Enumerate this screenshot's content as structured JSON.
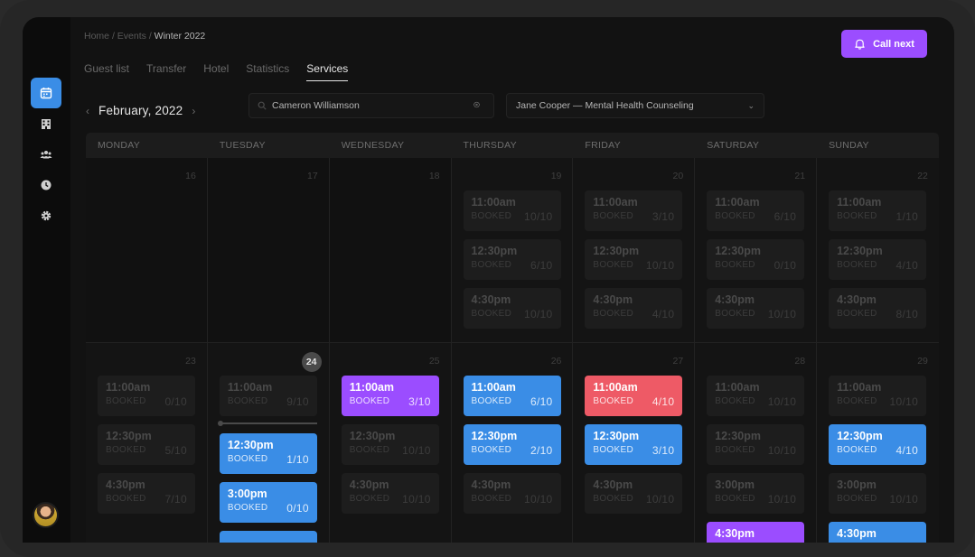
{
  "breadcrumb": {
    "items": [
      "Home",
      "Events"
    ],
    "separator": "/",
    "current": "Winter 2022"
  },
  "tabs": [
    {
      "label": "Guest list",
      "active": false
    },
    {
      "label": "Transfer",
      "active": false
    },
    {
      "label": "Hotel",
      "active": false
    },
    {
      "label": "Statistics",
      "active": false
    },
    {
      "label": "Services",
      "active": true
    }
  ],
  "call_button": {
    "label": "Call next",
    "icon": "bell-icon"
  },
  "sidebar": {
    "items": [
      {
        "name": "calendar",
        "icon": "calendar-icon",
        "active": true
      },
      {
        "name": "hotel",
        "icon": "building-icon",
        "active": false
      },
      {
        "name": "users",
        "icon": "users-icon",
        "active": false
      },
      {
        "name": "history",
        "icon": "clock-icon",
        "active": false
      },
      {
        "name": "settings",
        "icon": "gear-icon",
        "active": false
      }
    ]
  },
  "month": {
    "label": "February, 2022",
    "prev": "‹",
    "next": "›"
  },
  "search": {
    "value": "Cameron Williamson",
    "placeholder": "Search"
  },
  "service_select": {
    "value": "Jane Cooper — Mental Health Counseling"
  },
  "colors": {
    "accent_blue": "#3a8de6",
    "accent_purple": "#9b4dff",
    "accent_red": "#ee5a66"
  },
  "calendar": {
    "day_headers": [
      "MONDAY",
      "TUESDAY",
      "WEDNESDAY",
      "THURSDAY",
      "FRIDAY",
      "SATURDAY",
      "SUNDAY"
    ],
    "weeks": [
      {
        "days": [
          {
            "date": "16",
            "slots": []
          },
          {
            "date": "17",
            "slots": []
          },
          {
            "date": "18",
            "slots": []
          },
          {
            "date": "19",
            "slots": [
              {
                "time": "11:00am",
                "status": "BOOKED",
                "count": "10/10",
                "style": "past"
              },
              {
                "time": "12:30pm",
                "status": "BOOKED",
                "count": "6/10",
                "style": "past"
              },
              {
                "time": "4:30pm",
                "status": "BOOKED",
                "count": "10/10",
                "style": "past"
              }
            ]
          },
          {
            "date": "20",
            "slots": [
              {
                "time": "11:00am",
                "status": "BOOKED",
                "count": "3/10",
                "style": "past"
              },
              {
                "time": "12:30pm",
                "status": "BOOKED",
                "count": "10/10",
                "style": "past"
              },
              {
                "time": "4:30pm",
                "status": "BOOKED",
                "count": "4/10",
                "style": "past"
              }
            ]
          },
          {
            "date": "21",
            "slots": [
              {
                "time": "11:00am",
                "status": "BOOKED",
                "count": "6/10",
                "style": "past"
              },
              {
                "time": "12:30pm",
                "status": "BOOKED",
                "count": "0/10",
                "style": "past"
              },
              {
                "time": "4:30pm",
                "status": "BOOKED",
                "count": "10/10",
                "style": "past"
              }
            ]
          },
          {
            "date": "22",
            "slots": [
              {
                "time": "11:00am",
                "status": "BOOKED",
                "count": "1/10",
                "style": "past"
              },
              {
                "time": "12:30pm",
                "status": "BOOKED",
                "count": "4/10",
                "style": "past"
              },
              {
                "time": "4:30pm",
                "status": "BOOKED",
                "count": "8/10",
                "style": "past"
              }
            ]
          }
        ]
      },
      {
        "days": [
          {
            "date": "23",
            "slots": [
              {
                "time": "11:00am",
                "status": "BOOKED",
                "count": "0/10",
                "style": "past"
              },
              {
                "time": "12:30pm",
                "status": "BOOKED",
                "count": "5/10",
                "style": "past"
              },
              {
                "time": "4:30pm",
                "status": "BOOKED",
                "count": "7/10",
                "style": "past"
              }
            ]
          },
          {
            "date": "24",
            "today": true,
            "now_line": true,
            "slots": [
              {
                "time": "11:00am",
                "status": "BOOKED",
                "count": "9/10",
                "style": "past"
              },
              {
                "time": "12:30pm",
                "status": "BOOKED",
                "count": "1/10",
                "style": "blue"
              },
              {
                "time": "3:00pm",
                "status": "BOOKED",
                "count": "0/10",
                "style": "blue"
              },
              {
                "time": "",
                "status": "",
                "count": "",
                "style": "blue"
              }
            ]
          },
          {
            "date": "25",
            "slots": [
              {
                "time": "11:00am",
                "status": "BOOKED",
                "count": "3/10",
                "style": "purple"
              },
              {
                "time": "12:30pm",
                "status": "BOOKED",
                "count": "10/10",
                "style": "past"
              },
              {
                "time": "4:30pm",
                "status": "BOOKED",
                "count": "10/10",
                "style": "past"
              }
            ]
          },
          {
            "date": "26",
            "slots": [
              {
                "time": "11:00am",
                "status": "BOOKED",
                "count": "6/10",
                "style": "blue"
              },
              {
                "time": "12:30pm",
                "status": "BOOKED",
                "count": "2/10",
                "style": "blue"
              },
              {
                "time": "4:30pm",
                "status": "BOOKED",
                "count": "10/10",
                "style": "past"
              }
            ]
          },
          {
            "date": "27",
            "slots": [
              {
                "time": "11:00am",
                "status": "BOOKED",
                "count": "4/10",
                "style": "red"
              },
              {
                "time": "12:30pm",
                "status": "BOOKED",
                "count": "3/10",
                "style": "blue"
              },
              {
                "time": "4:30pm",
                "status": "BOOKED",
                "count": "10/10",
                "style": "past"
              }
            ]
          },
          {
            "date": "28",
            "slots": [
              {
                "time": "11:00am",
                "status": "BOOKED",
                "count": "10/10",
                "style": "past"
              },
              {
                "time": "12:30pm",
                "status": "BOOKED",
                "count": "10/10",
                "style": "past"
              },
              {
                "time": "3:00pm",
                "status": "BOOKED",
                "count": "10/10",
                "style": "past"
              },
              {
                "time": "4:30pm",
                "status": "",
                "count": "",
                "style": "purple"
              }
            ]
          },
          {
            "date": "29",
            "slots": [
              {
                "time": "11:00am",
                "status": "BOOKED",
                "count": "10/10",
                "style": "past"
              },
              {
                "time": "12:30pm",
                "status": "BOOKED",
                "count": "4/10",
                "style": "blue"
              },
              {
                "time": "3:00pm",
                "status": "BOOKED",
                "count": "10/10",
                "style": "past"
              },
              {
                "time": "4:30pm",
                "status": "",
                "count": "",
                "style": "blue"
              }
            ]
          }
        ]
      }
    ]
  }
}
